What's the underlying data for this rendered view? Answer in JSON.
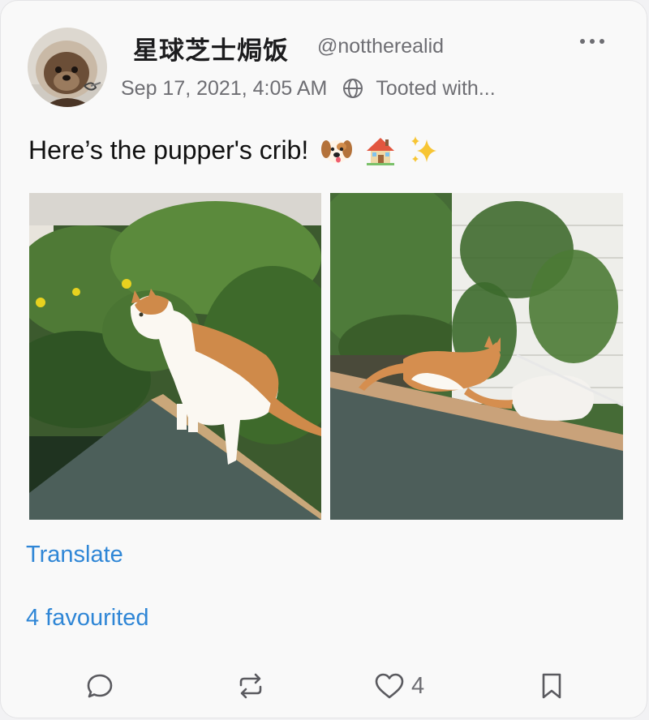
{
  "post": {
    "display_name": "星球芝士焗饭",
    "handle": "@notthereal​id",
    "timestamp": "Sep 17, 2021, 4:05 AM",
    "client": "Tooted with...",
    "text": "Here’s the pupper's crib!",
    "emojis": [
      "dog-face",
      "house",
      "sparkles"
    ],
    "media": [
      {
        "description": "orange-and-white cat standing on a roof edge in front of greenery"
      },
      {
        "description": "orange cat and white cat on a roof edge near ivy-covered wall"
      }
    ]
  },
  "links": {
    "translate": "Translate",
    "favourited": "4 favourited"
  },
  "actions": {
    "reply_icon": "speech-bubble-icon",
    "boost_icon": "repeat-icon",
    "favourite_icon": "heart-icon",
    "favourite_count": "4",
    "bookmark_icon": "bookmark-icon"
  },
  "colors": {
    "accent": "#2f86d6",
    "secondary_text": "#6e6e73",
    "card_background": "#f9f9f9"
  }
}
